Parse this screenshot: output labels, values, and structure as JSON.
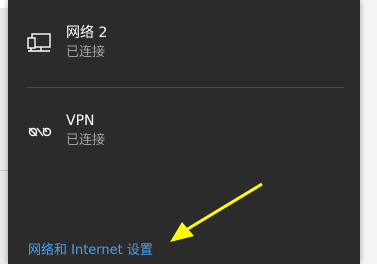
{
  "networks": [
    {
      "name": "网络 2",
      "status": "已连接",
      "icon": "ethernet-icon"
    },
    {
      "name": "VPN",
      "status": "已连接",
      "icon": "vpn-icon"
    }
  ],
  "settings_link": {
    "label": "网络和 Internet 设置"
  },
  "colors": {
    "flyout_bg": "#2b2b2b",
    "primary_text": "#ffffff",
    "secondary_text": "#a0a0a0",
    "link": "#4aa3f0",
    "annotation_arrow": "#ffff00"
  }
}
